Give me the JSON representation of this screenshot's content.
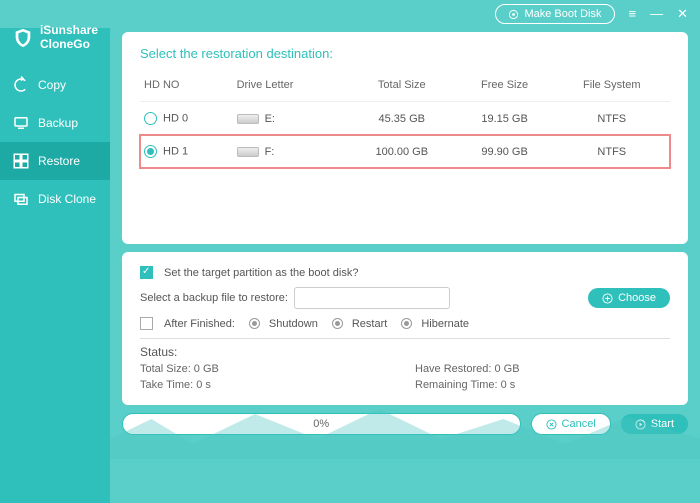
{
  "app": {
    "name1": "iSunshare",
    "name2": "CloneGo"
  },
  "titlebar": {
    "boot_label": "Make Boot Disk"
  },
  "nav": {
    "copy": "Copy",
    "backup": "Backup",
    "restore": "Restore",
    "diskclone": "Disk Clone"
  },
  "top_panel": {
    "title": "Select the restoration destination:",
    "cols": {
      "hdno": "HD NO",
      "letter": "Drive Letter",
      "total": "Total Size",
      "free": "Free Size",
      "fs": "File System"
    },
    "rows": [
      {
        "id": "HD 0",
        "letter": "E:",
        "total": "45.35 GB",
        "free": "19.15 GB",
        "fs": "NTFS",
        "selected": false
      },
      {
        "id": "HD 1",
        "letter": "F:",
        "total": "100.00 GB",
        "free": "99.90 GB",
        "fs": "NTFS",
        "selected": true
      }
    ]
  },
  "mid_panel": {
    "set_boot_label": "Set the target partition as the boot disk?",
    "select_file_label": "Select a backup file to restore:",
    "choose_label": "Choose",
    "after_label": "After Finished:",
    "opt_shutdown": "Shutdown",
    "opt_restart": "Restart",
    "opt_hibernate": "Hibernate",
    "status_title": "Status:",
    "total_size": "Total Size: 0 GB",
    "have_restored": "Have Restored: 0 GB",
    "take_time": "Take Time: 0 s",
    "remaining": "Remaining Time: 0 s"
  },
  "bottom": {
    "progress": "0%",
    "cancel": "Cancel",
    "start": "Start"
  }
}
